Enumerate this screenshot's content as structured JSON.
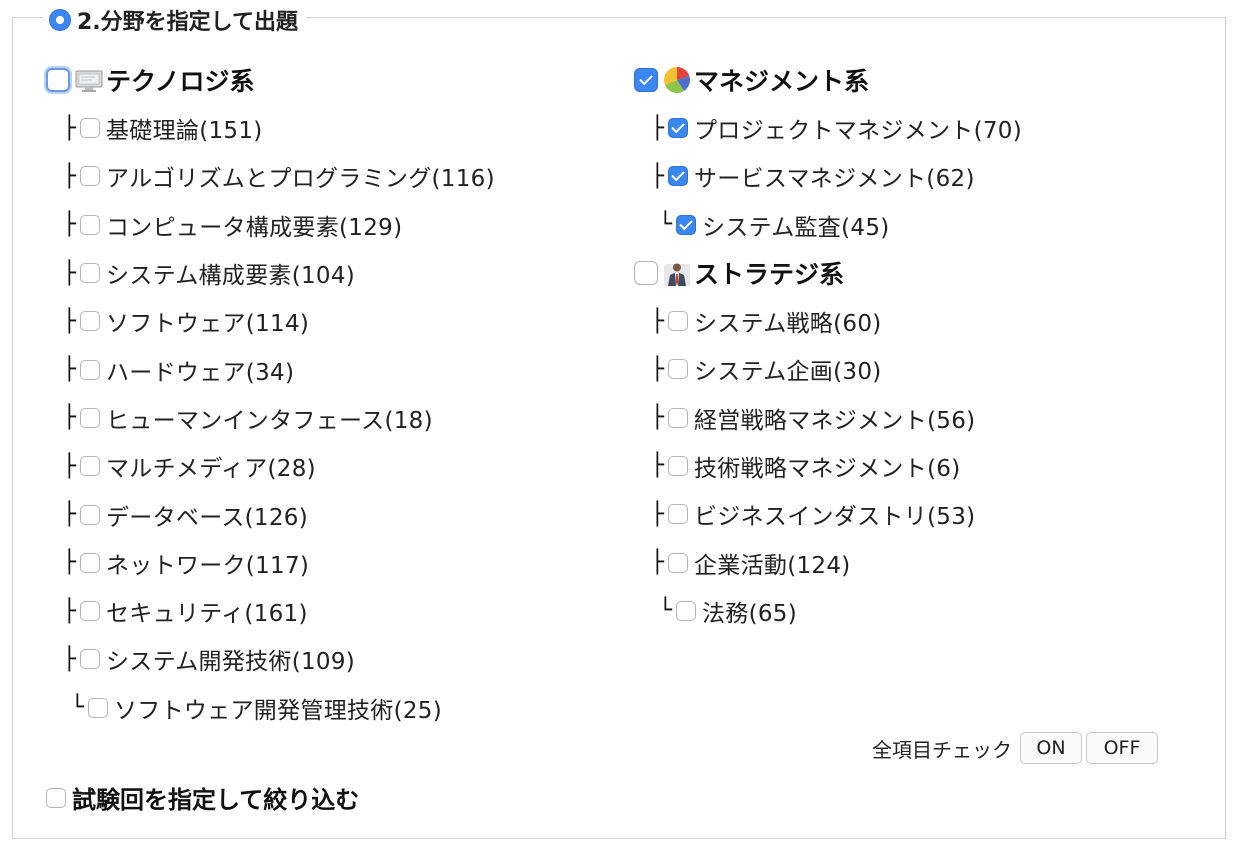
{
  "legend": {
    "title": "2.分野を指定して出題"
  },
  "left": {
    "category": {
      "label": "テクノロジ系",
      "checked": false,
      "icon": "monitor-icon"
    },
    "items": [
      {
        "label": "基礎理論(151)",
        "checked": false
      },
      {
        "label": "アルゴリズムとプログラミング(116)",
        "checked": false
      },
      {
        "label": "コンピュータ構成要素(129)",
        "checked": false
      },
      {
        "label": "システム構成要素(104)",
        "checked": false
      },
      {
        "label": "ソフトウェア(114)",
        "checked": false
      },
      {
        "label": "ハードウェア(34)",
        "checked": false
      },
      {
        "label": "ヒューマンインタフェース(18)",
        "checked": false
      },
      {
        "label": "マルチメディア(28)",
        "checked": false
      },
      {
        "label": "データベース(126)",
        "checked": false
      },
      {
        "label": "ネットワーク(117)",
        "checked": false
      },
      {
        "label": "セキュリティ(161)",
        "checked": false
      },
      {
        "label": "システム開発技術(109)",
        "checked": false
      },
      {
        "label": "ソフトウェア開発管理技術(25)",
        "checked": false
      }
    ]
  },
  "right": {
    "management": {
      "category": {
        "label": "マネジメント系",
        "checked": true,
        "icon": "pie-chart-icon"
      },
      "items": [
        {
          "label": "プロジェクトマネジメント(70)",
          "checked": true
        },
        {
          "label": "サービスマネジメント(62)",
          "checked": true
        },
        {
          "label": "システム監査(45)",
          "checked": true
        }
      ]
    },
    "strategy": {
      "category": {
        "label": "ストラテジ系",
        "checked": false,
        "icon": "businessman-icon"
      },
      "items": [
        {
          "label": "システム戦略(60)",
          "checked": false
        },
        {
          "label": "システム企画(30)",
          "checked": false
        },
        {
          "label": "経営戦略マネジメント(56)",
          "checked": false
        },
        {
          "label": "技術戦略マネジメント(6)",
          "checked": false
        },
        {
          "label": "ビジネスインダストリ(53)",
          "checked": false
        },
        {
          "label": "企業活動(124)",
          "checked": false
        },
        {
          "label": "法務(65)",
          "checked": false
        }
      ]
    }
  },
  "tree": {
    "branch": "├",
    "last": "└"
  },
  "check_all": {
    "label": "全項目チェック",
    "on": "ON",
    "off": "OFF"
  },
  "exam": {
    "label": "試験回を指定して絞り込む",
    "checked": false
  },
  "colors": {
    "accent": "#3b87f0",
    "border": "#cfcfcf"
  }
}
